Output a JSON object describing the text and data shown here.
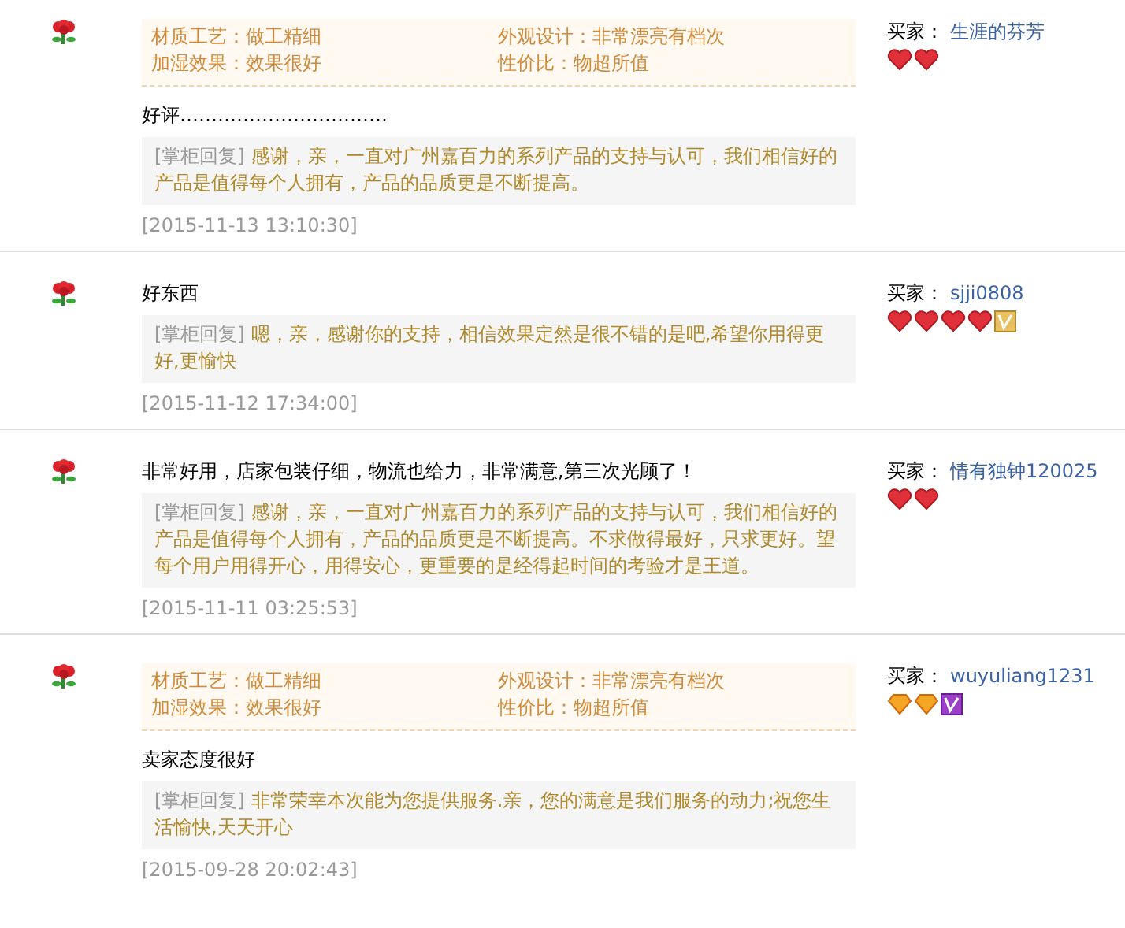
{
  "reviews": [
    {
      "attributes": [
        {
          "label": "材质工艺：做工精细"
        },
        {
          "label": "外观设计：非常漂亮有档次"
        },
        {
          "label": "加湿效果：效果很好"
        },
        {
          "label": "性价比：物超所值"
        }
      ],
      "comment": "好评……………………………",
      "reply_label": "[掌柜回复]",
      "reply": "感谢，亲，一直对广州嘉百力的系列产品的支持与认可，我们相信好的产品是值得每个人拥有，产品的品质更是不断提高。",
      "date": "[2015-11-13 13:10:30]",
      "buyer_label": "买家：",
      "buyer": "生涯的芬芳",
      "badges": [
        {
          "kind": "heart"
        },
        {
          "kind": "heart"
        }
      ]
    },
    {
      "comment": "好东西",
      "reply_label": "[掌柜回复]",
      "reply": "嗯，亲，感谢你的支持，相信效果定然是很不错的是吧,希望你用得更好,更愉快",
      "date": "[2015-11-12 17:34:00]",
      "buyer_label": "买家：",
      "buyer": "sjji0808",
      "badges": [
        {
          "kind": "heart"
        },
        {
          "kind": "heart"
        },
        {
          "kind": "heart"
        },
        {
          "kind": "heart"
        },
        {
          "kind": "vip-gold"
        }
      ]
    },
    {
      "comment": "非常好用，店家包装仔细，物流也给力，非常满意,第三次光顾了！",
      "reply_label": "[掌柜回复]",
      "reply": "感谢，亲，一直对广州嘉百力的系列产品的支持与认可，我们相信好的产品是值得每个人拥有，产品的品质更是不断提高。不求做得最好，只求更好。望每个用户用得开心，用得安心，更重要的是经得起时间的考验才是王道。",
      "date": "[2015-11-11 03:25:53]",
      "buyer_label": "买家：",
      "buyer": "情有独钟120025",
      "badges": [
        {
          "kind": "heart"
        },
        {
          "kind": "heart"
        }
      ]
    },
    {
      "attributes": [
        {
          "label": "材质工艺：做工精细"
        },
        {
          "label": "外观设计：非常漂亮有档次"
        },
        {
          "label": "加湿效果：效果很好"
        },
        {
          "label": "性价比：物超所值"
        }
      ],
      "comment": "卖家态度很好",
      "reply_label": "[掌柜回复]",
      "reply": "非常荣幸本次能为您提供服务.亲，您的满意是我们服务的动力;祝您生活愉快,天天开心",
      "date": "[2015-09-28 20:02:43]",
      "buyer_label": "买家：",
      "buyer": "wuyuliang1231",
      "badges": [
        {
          "kind": "diamond"
        },
        {
          "kind": "diamond"
        },
        {
          "kind": "vip-purple"
        }
      ]
    }
  ]
}
